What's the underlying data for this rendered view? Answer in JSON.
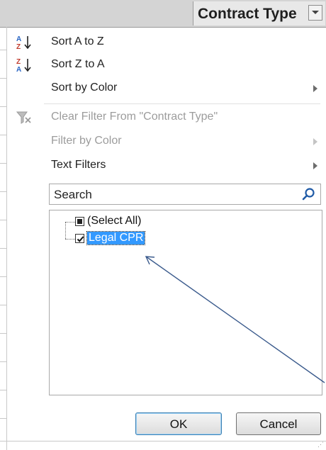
{
  "header": {
    "column_title": "Contract Type"
  },
  "menu": {
    "items": [
      {
        "label": "Sort A to Z",
        "icon": "sort-ascending-icon",
        "disabled": false,
        "submenu": false
      },
      {
        "label": "Sort Z to A",
        "icon": "sort-descending-icon",
        "disabled": false,
        "submenu": false
      },
      {
        "label": "Sort by Color",
        "icon": "",
        "disabled": false,
        "submenu": true
      },
      {
        "label": "Clear Filter From \"Contract Type\"",
        "icon": "clear-filter-icon",
        "disabled": true,
        "submenu": false
      },
      {
        "label": "Filter by Color",
        "icon": "",
        "disabled": true,
        "submenu": true
      },
      {
        "label": "Text Filters",
        "icon": "",
        "disabled": false,
        "submenu": true
      }
    ]
  },
  "search": {
    "placeholder": "Search"
  },
  "list": {
    "items": [
      {
        "label": "(Select All)",
        "state": "partial"
      },
      {
        "label": "Legal CPR",
        "state": "checked",
        "selected": true
      }
    ]
  },
  "buttons": {
    "ok": "OK",
    "cancel": "Cancel"
  },
  "colors": {
    "selection": "#3399ff",
    "annotation_arrow": "#3a5a8c"
  }
}
